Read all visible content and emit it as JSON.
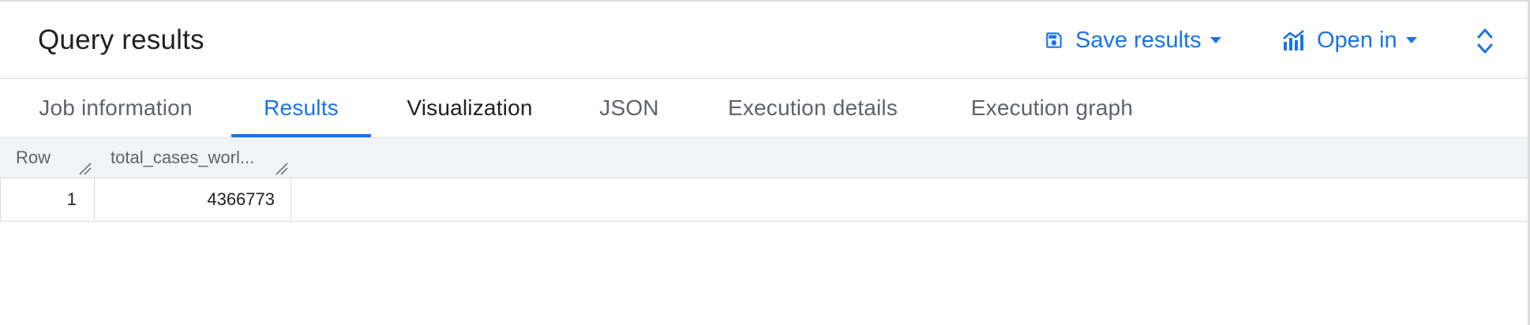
{
  "header": {
    "title": "Query results",
    "save_results_label": "Save results",
    "open_in_label": "Open in"
  },
  "tabs": [
    {
      "label": "Job information",
      "active": false
    },
    {
      "label": "Results",
      "active": true
    },
    {
      "label": "Visualization",
      "active": false
    },
    {
      "label": "JSON",
      "active": false
    },
    {
      "label": "Execution details",
      "active": false
    },
    {
      "label": "Execution graph",
      "active": false
    }
  ],
  "table": {
    "columns": [
      "Row",
      "total_cases_worl..."
    ],
    "rows": [
      {
        "row": "1",
        "total_cases_worldwide": "4366773"
      }
    ]
  },
  "colors": {
    "accent": "#1a73e8",
    "text_primary": "#202124",
    "text_secondary": "#5f6368",
    "header_bg": "#f1f3f4",
    "border": "#dadce0"
  },
  "icons": {
    "save": "floppy-disk-icon",
    "open_in": "analytics-chart-icon",
    "caret": "caret-down-icon",
    "expand": "unfold-more-icon",
    "resize": "column-resize-icon"
  }
}
